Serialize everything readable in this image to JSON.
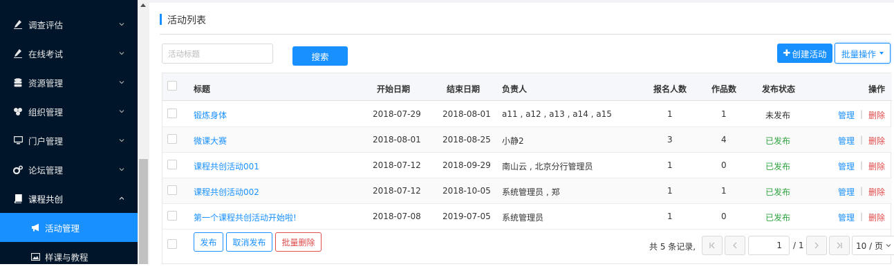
{
  "sidebar": {
    "items": [
      {
        "label": "调查评估",
        "icon": "pen-icon"
      },
      {
        "label": "在线考试",
        "icon": "pen-icon"
      },
      {
        "label": "资源管理",
        "icon": "database-icon"
      },
      {
        "label": "组织管理",
        "icon": "sitemap-icon"
      },
      {
        "label": "门户管理",
        "icon": "monitor-icon"
      },
      {
        "label": "论坛管理",
        "icon": "gears-icon"
      },
      {
        "label": "课程共创",
        "icon": "book-icon"
      }
    ],
    "subitems": [
      {
        "label": "活动管理",
        "icon": "bullhorn-icon",
        "active": true
      },
      {
        "label": "样课与教程",
        "icon": "image-icon",
        "active": false
      }
    ],
    "active_color": "#1890ff",
    "background": "#001529"
  },
  "page": {
    "title": "活动列表"
  },
  "search": {
    "placeholder": "活动标题",
    "value": "",
    "button_label": "搜索"
  },
  "toolbar": {
    "create_label": "创建活动",
    "batch_label": "批量操作"
  },
  "table": {
    "headers": {
      "title": "标题",
      "start": "开始日期",
      "end": "结束日期",
      "owner": "负责人",
      "signups": "报名人数",
      "works": "作品数",
      "status": "发布状态",
      "actions": "操作"
    },
    "rows": [
      {
        "title": "锻炼身体",
        "start": "2018-07-29",
        "end": "2018-08-01",
        "owner": "a11 , a12 , a13 , a14 , a15",
        "signups": "1",
        "works": "1",
        "status": "未发布",
        "published": false
      },
      {
        "title": "微课大赛",
        "start": "2018-08-01",
        "end": "2018-08-25",
        "owner": "小静2",
        "signups": "3",
        "works": "4",
        "status": "已发布",
        "published": true
      },
      {
        "title": "课程共创活动001",
        "start": "2018-07-12",
        "end": "2018-09-29",
        "owner": "南山云 , 北京分行管理员",
        "signups": "1",
        "works": "0",
        "status": "已发布",
        "published": true
      },
      {
        "title": "课程共创活动002",
        "start": "2018-07-12",
        "end": "2018-10-05",
        "owner": "系统管理员 , 郑",
        "signups": "1",
        "works": "1",
        "status": "已发布",
        "published": true
      },
      {
        "title": "第一个课程共创活动开始啦!",
        "start": "2018-07-08",
        "end": "2019-07-05",
        "owner": "系统管理员",
        "signups": "1",
        "works": "0",
        "status": "已发布",
        "published": true
      }
    ],
    "action_manage": "管理",
    "action_separator": "|",
    "action_delete": "删除"
  },
  "footer": {
    "publish_label": "发布",
    "unpublish_label": "取消发布",
    "batch_delete_label": "批量删除"
  },
  "pagination": {
    "total_text": "共 5 条记录,",
    "current_page": "1",
    "total_pages_text": "/ 1",
    "page_size_text": "10 / 页"
  },
  "colors": {
    "primary": "#1890ff",
    "danger": "#e04b4b",
    "success": "#2fa33f"
  }
}
